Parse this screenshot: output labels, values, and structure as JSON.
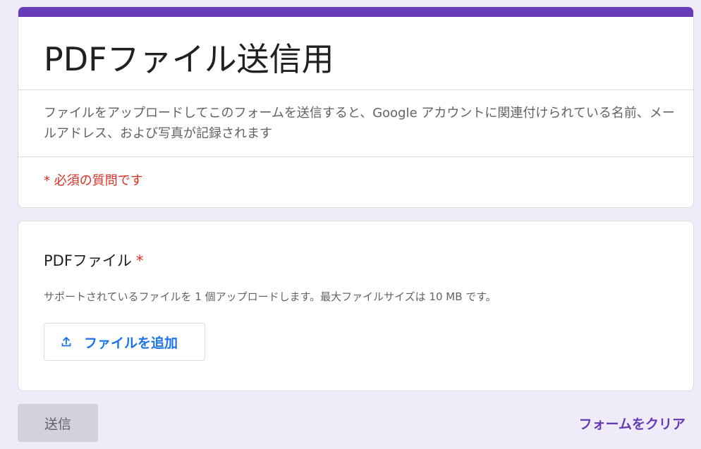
{
  "header": {
    "title": "PDFファイル送信用",
    "description": "ファイルをアップロードしてこのフォームを送信すると、Google アカウントに関連付けられている名前、メールアドレス、および写真が記録されます",
    "required_note": "* 必須の質問です"
  },
  "question": {
    "title": "PDFファイル",
    "required_mark": "*",
    "help_text": "サポートされているファイルを 1 個アップロードします。最大ファイルサイズは 10 MB です。",
    "upload_label": "ファイルを追加",
    "upload_icon": "upload-icon"
  },
  "footer": {
    "submit_label": "送信",
    "clear_label": "フォームをクリア"
  },
  "colors": {
    "accent": "#673ab7",
    "background": "#f0ebf8",
    "required": "#d93025",
    "link_blue": "#1a73e8"
  }
}
